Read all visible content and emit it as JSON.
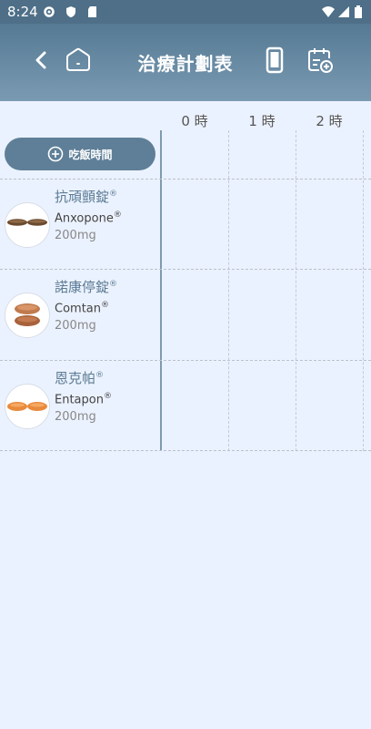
{
  "statusbar": {
    "time": "8:24"
  },
  "appbar": {
    "title": "治療計劃表"
  },
  "schedule": {
    "hours": [
      "0 時",
      "1 時",
      "2 時"
    ],
    "meal_button_label": "吃飯時間"
  },
  "drugs": [
    {
      "name": "抗頑顫錠",
      "reg": "®",
      "english": "Anxopone",
      "ereg": "®",
      "dose": "200mg"
    },
    {
      "name": "諾康停錠",
      "reg": "®",
      "english": "Comtan",
      "ereg": "®",
      "dose": "200mg"
    },
    {
      "name": "恩克帕",
      "reg": "®",
      "english": "Entapon",
      "ereg": "®",
      "dose": "200mg"
    }
  ]
}
